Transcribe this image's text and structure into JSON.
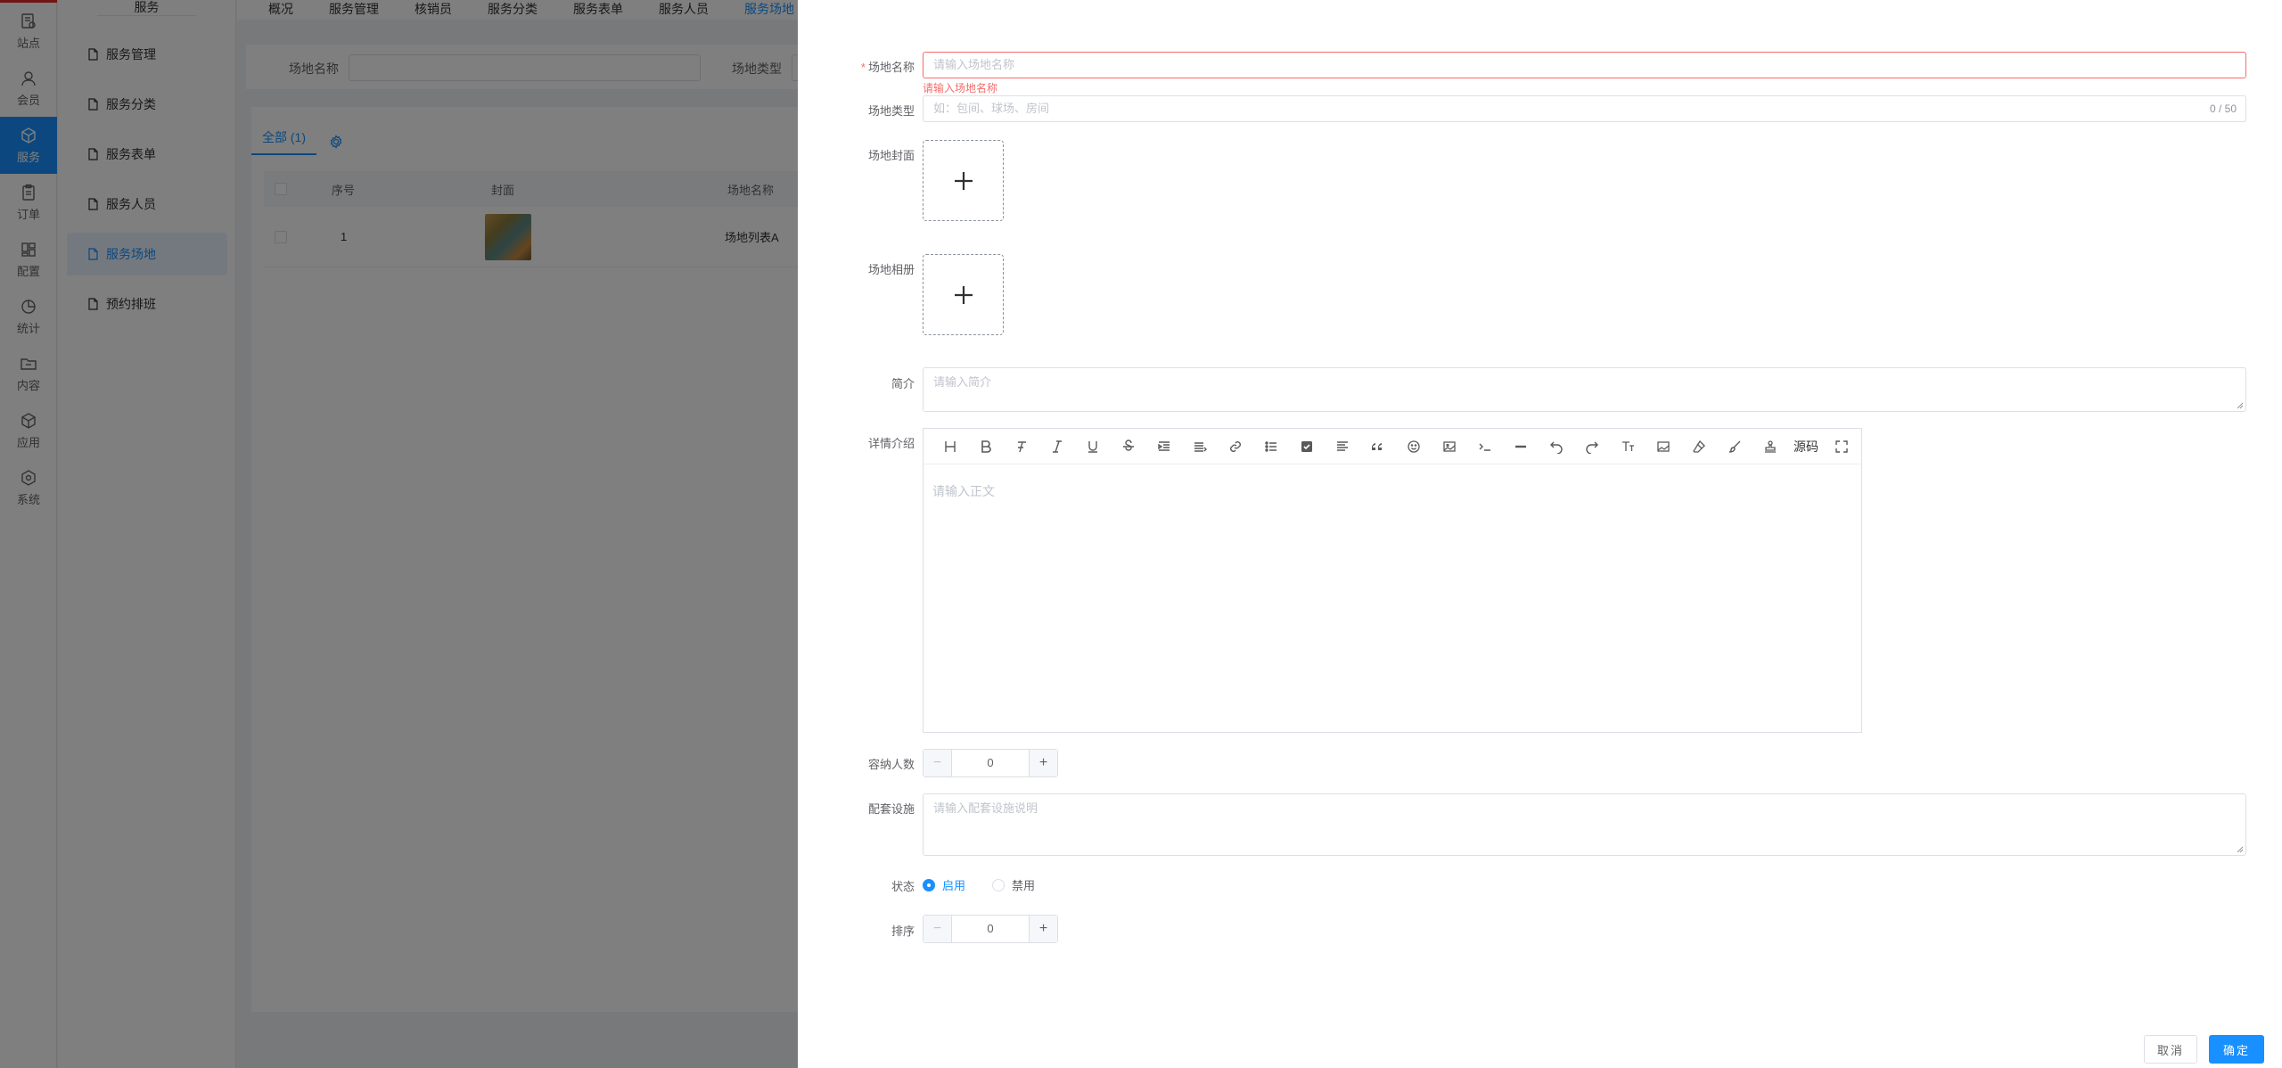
{
  "rail": {
    "items": [
      {
        "label": "站点",
        "icon": "site-icon"
      },
      {
        "label": "会员",
        "icon": "member-icon"
      },
      {
        "label": "服务",
        "icon": "box-icon",
        "active": true
      },
      {
        "label": "订单",
        "icon": "order-icon"
      },
      {
        "label": "配置",
        "icon": "config-icon"
      },
      {
        "label": "统计",
        "icon": "stats-icon"
      },
      {
        "label": "内容",
        "icon": "folder-icon"
      },
      {
        "label": "应用",
        "icon": "app-icon"
      },
      {
        "label": "系统",
        "icon": "system-icon"
      }
    ]
  },
  "submenu": {
    "title": "服务",
    "items": [
      "服务管理",
      "服务分类",
      "服务表单",
      "服务人员",
      "服务场地",
      "预约排班"
    ],
    "active_index": 4
  },
  "top_tabs": [
    "概况",
    "服务管理",
    "核销员",
    "服务分类",
    "服务表单",
    "服务人员",
    "服务场地"
  ],
  "filter": {
    "name_label": "场地名称",
    "type_label": "场地类型"
  },
  "list": {
    "tab_all": "全部 (1)",
    "columns": [
      "序号",
      "封面",
      "场地名称"
    ],
    "rows": [
      {
        "index": "1",
        "name": "场地列表A"
      }
    ]
  },
  "form": {
    "name": {
      "label": "场地名称",
      "placeholder": "请输入场地名称",
      "error": "请输入场地名称"
    },
    "type": {
      "label": "场地类型",
      "placeholder": "如：包间、球场、房间",
      "count": "0 / 50"
    },
    "cover": {
      "label": "场地封面"
    },
    "album": {
      "label": "场地相册"
    },
    "intro": {
      "label": "简介",
      "placeholder": "请输入简介"
    },
    "detail": {
      "label": "详情介绍",
      "placeholder": "请输入正文",
      "toolbar": [
        "heading-icon",
        "bold-icon",
        "clear-format-icon",
        "italic-icon",
        "underline-icon",
        "strikethrough-icon",
        "indent-icon",
        "align-icon",
        "link-icon",
        "list-icon",
        "checkbox-icon",
        "justify-icon",
        "quote-icon",
        "emoji-icon",
        "image-icon",
        "code-icon",
        "hr-icon",
        "undo-icon",
        "redo-icon",
        "font-size-icon",
        "image-upload-icon",
        "eraser-icon",
        "brush-icon",
        "stamp-icon"
      ],
      "source_label": "源码"
    },
    "capacity": {
      "label": "容纳人数",
      "value": "0"
    },
    "facility": {
      "label": "配套设施",
      "placeholder": "请输入配套设施说明"
    },
    "status": {
      "label": "状态",
      "options": [
        "启用",
        "禁用"
      ],
      "selected": "启用"
    },
    "sort": {
      "label": "排序",
      "value": "0"
    }
  },
  "footer": {
    "cancel": "取消",
    "confirm": "确定"
  },
  "colors": {
    "primary": "#1890ff",
    "danger": "#f56c6c",
    "overlay": "rgba(0,0,0,0.5)"
  }
}
